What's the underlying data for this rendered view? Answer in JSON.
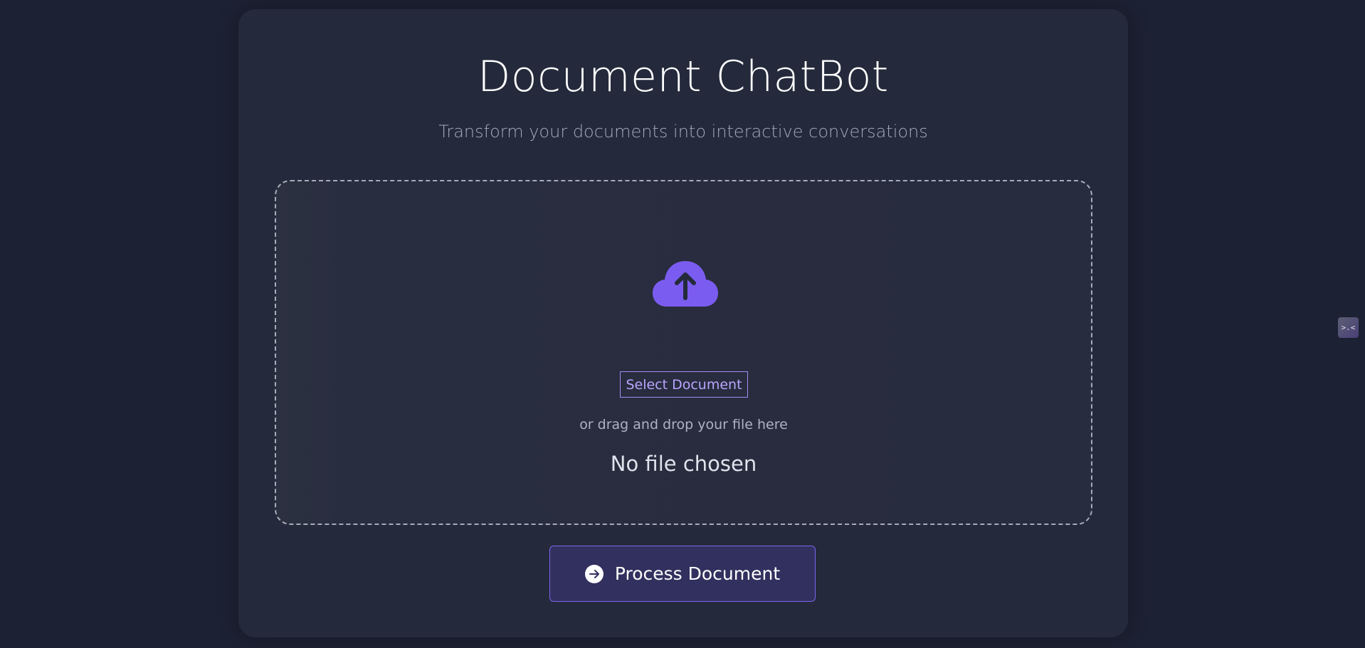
{
  "header": {
    "title": "Document ChatBot",
    "subtitle": "Transform your documents into interactive conversations"
  },
  "upload": {
    "icon": "cloud-upload-icon",
    "select_label": "Select Document",
    "drag_hint": "or drag and drop your file here",
    "file_status": "No file chosen"
  },
  "actions": {
    "process_label": "Process Document",
    "process_icon": "arrow-right-circle-icon"
  },
  "side_widget": {
    "icon": "face-icon",
    "glyph": ">.<"
  },
  "colors": {
    "background": "#1c2133",
    "card": "#242a3b",
    "accent": "#7b5cf0",
    "button_bg": "#32305e"
  }
}
